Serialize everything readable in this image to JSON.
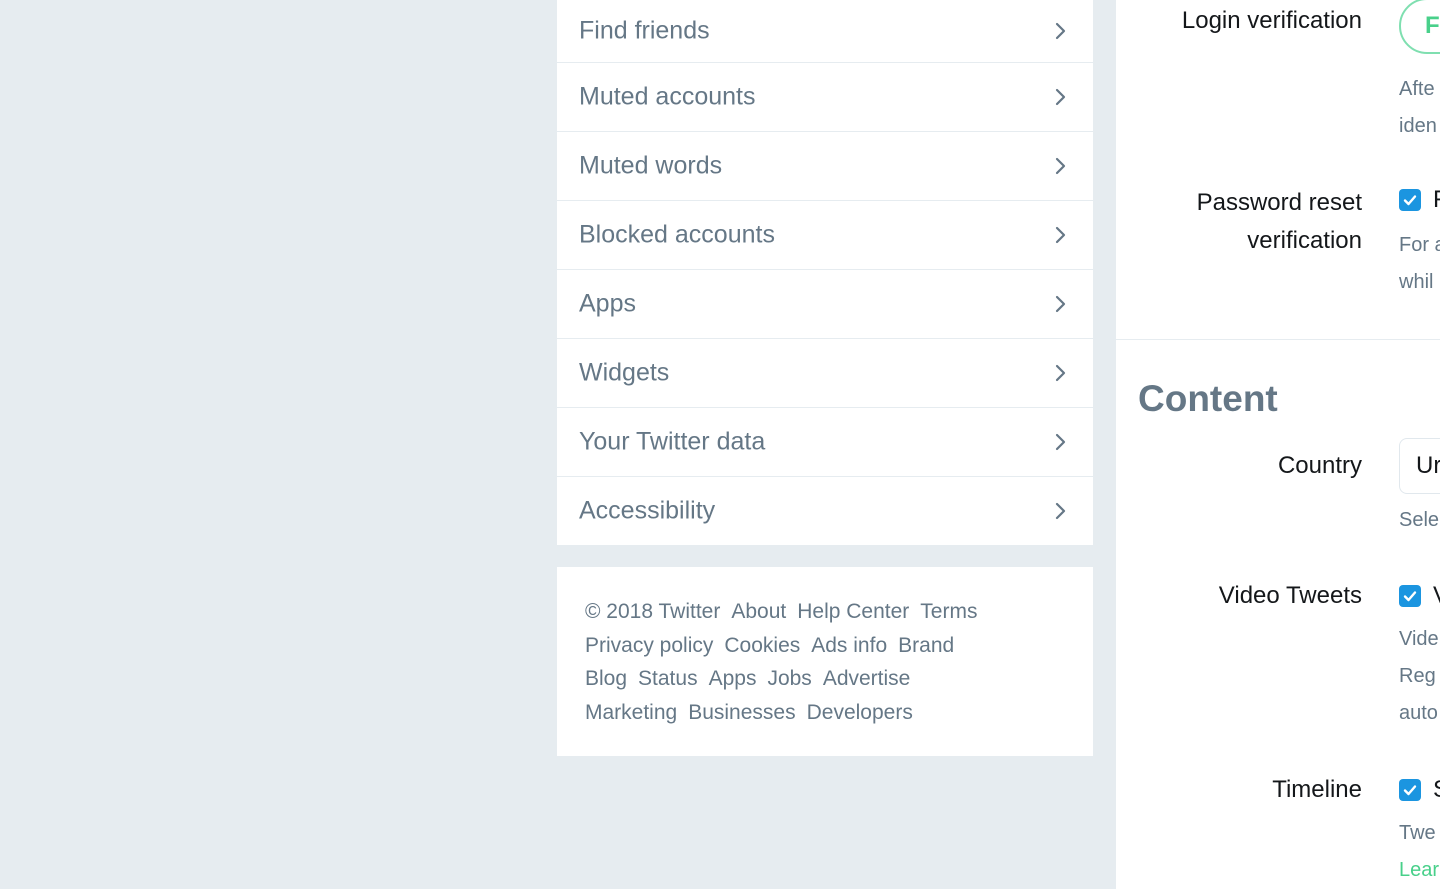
{
  "nav": {
    "items": [
      {
        "label": "Find friends"
      },
      {
        "label": "Muted accounts"
      },
      {
        "label": "Muted words"
      },
      {
        "label": "Blocked accounts"
      },
      {
        "label": "Apps"
      },
      {
        "label": "Widgets"
      },
      {
        "label": "Your Twitter data"
      },
      {
        "label": "Accessibility"
      }
    ],
    "chevron_icon": "chevron-right-icon"
  },
  "footer": {
    "copyright": "© 2018 Twitter",
    "links": [
      "About",
      "Help Center",
      "Terms",
      "Privacy policy",
      "Cookies",
      "Ads info",
      "Brand",
      "Blog",
      "Status",
      "Apps",
      "Jobs",
      "Advertise",
      "Marketing",
      "Businesses",
      "Developers"
    ]
  },
  "security": {
    "login_verification": {
      "label": "Login verification",
      "button_label": "F",
      "help_line1": "Afte",
      "help_line2": "iden"
    },
    "password_reset": {
      "label_line1": "Password reset",
      "label_line2": "verification",
      "checked": true,
      "checkbox_text": "F",
      "help_line1": "For a",
      "help_line2": "whil"
    }
  },
  "content": {
    "section_title": "Content",
    "country": {
      "label": "Country",
      "selected_value": "Ur",
      "help": "Sele"
    },
    "video_tweets": {
      "label": "Video Tweets",
      "checked": true,
      "checkbox_text": "V",
      "help_line1": "Vide",
      "help_line2": "Reg",
      "help_line3": "auto"
    },
    "timeline": {
      "label": "Timeline",
      "checked": true,
      "checkbox_text": "S",
      "help_line1": "Twe",
      "learn_more": "Lear"
    }
  },
  "colors": {
    "page_bg": "#e6ecf0",
    "card_bg": "#ffffff",
    "muted_text": "#657786",
    "primary_text": "#14171a",
    "checkbox_blue": "#1b95e0",
    "accent_green": "#48d08a"
  }
}
